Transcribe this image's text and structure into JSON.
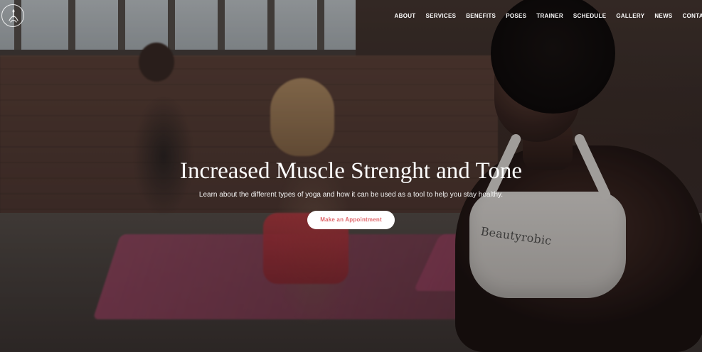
{
  "nav": {
    "brand_icon": "yoga-logo-icon",
    "items": [
      {
        "label": "ABOUT"
      },
      {
        "label": "SERVICES"
      },
      {
        "label": "BENEFITS"
      },
      {
        "label": "POSES"
      },
      {
        "label": "TRAINER"
      },
      {
        "label": "SCHEDULE"
      },
      {
        "label": "GALLERY"
      },
      {
        "label": "NEWS"
      },
      {
        "label": "CONTAC"
      }
    ]
  },
  "hero": {
    "title": "Increased Muscle Strenght and Tone",
    "subtitle": "Learn about the different types of yoga and how it can be used as a tool to help you stay healthy.",
    "cta_label": "Make an Appointment",
    "cta_text_color": "#e0676b"
  },
  "apparel": {
    "print": "Beautyrobic"
  }
}
